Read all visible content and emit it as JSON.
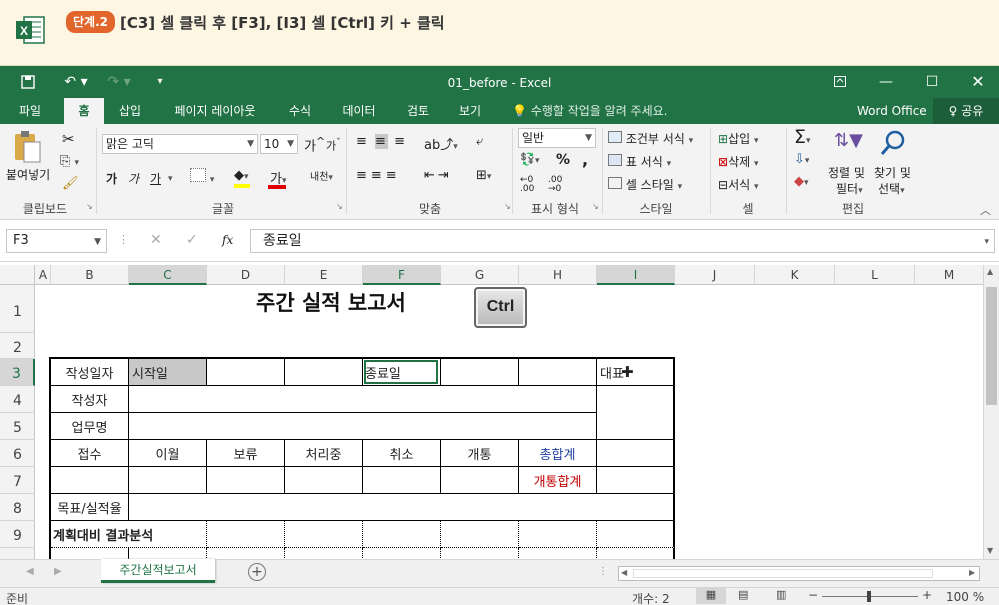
{
  "banner": {
    "step_badge": "단계.2",
    "instruction": "[C3] 셀 클릭 후 [F3], [I3] 셀 [Ctrl] 키 + 클릭"
  },
  "window": {
    "title": "01_before - Excel"
  },
  "tabs": [
    "파일",
    "홈",
    "삽입",
    "페이지 레이아웃",
    "수식",
    "데이터",
    "검토",
    "보기"
  ],
  "tell_me": "수행할 작업을 알려 주세요.",
  "account": "Word Office",
  "share": "공유",
  "ribbon": {
    "paste": "붙여넣기",
    "clipboard": "클립보드",
    "font_name": "맑은 고딕",
    "font_size": "10",
    "font_group": "글꼴",
    "align_group": "맞춤",
    "number_format": "일반",
    "number_group": "표시 형식",
    "cond_format": "조건부 서식",
    "table_format": "표 서식",
    "cell_style": "셀 스타일",
    "style_group": "스타일",
    "insert": "삽입",
    "delete": "삭제",
    "format": "서식",
    "cells_group": "셀",
    "sort_filter_1": "정렬 및",
    "sort_filter_2": "필터",
    "find_select_1": "찾기 및",
    "find_select_2": "선택",
    "edit_group": "편집",
    "bold": "가",
    "italic": "가",
    "underline": "가",
    "font_color": "가",
    "grow": "가",
    "shrink": "가",
    "phonetic": "내천",
    "percent": "%",
    "comma": ","
  },
  "formula_bar": {
    "name_box": "F3",
    "fx": "fx",
    "formula": "종료일"
  },
  "columns": [
    "A",
    "B",
    "C",
    "D",
    "E",
    "F",
    "G",
    "H",
    "I",
    "J",
    "K",
    "L",
    "M"
  ],
  "rows": [
    "1",
    "2",
    "3",
    "4",
    "5",
    "6",
    "7",
    "8",
    "9"
  ],
  "sheet": {
    "title": "주간 실적 보고서",
    "ctrl_key": "Ctrl",
    "r3": {
      "B": "작성일자",
      "C": "시작일",
      "F": "종료일",
      "I": "대표"
    },
    "r4": {
      "B": "작성자"
    },
    "r5": {
      "B": "업무명"
    },
    "r6": {
      "B": "접수",
      "C": "이월",
      "D": "보류",
      "E": "처리중",
      "F": "취소",
      "G": "개통",
      "H": "총합계"
    },
    "r7": {
      "H": "개통합계"
    },
    "r8": {
      "B": "목표/실적율"
    },
    "r9": {
      "B": "계획대비 결과분석"
    }
  },
  "sheet_tab": "주간실적보고서",
  "status": {
    "ready": "준비",
    "count": "개수: 2",
    "zoom": "100 %"
  },
  "colors": {
    "excel_green": "#217346",
    "selected_fill": "#c8c8c8",
    "total_blue": "#1f3fa0",
    "total_red": "#c00000"
  }
}
